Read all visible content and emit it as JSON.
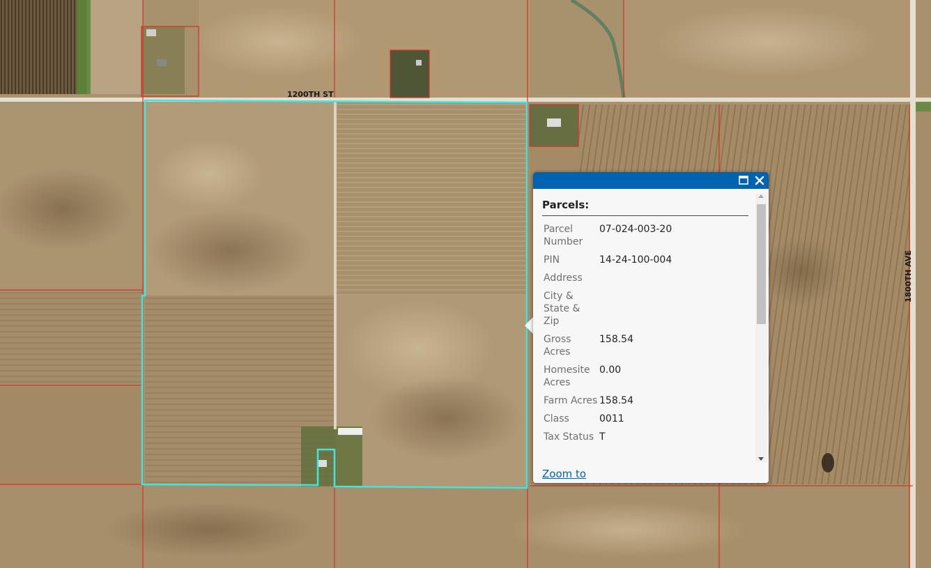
{
  "map": {
    "roads": {
      "horizontal_label": "1200TH ST",
      "vertical_label": "1800TH AVE"
    },
    "colors": {
      "field_base": "#a48a64",
      "parcel_line": "#d9302a",
      "selected_parcel": "#3ee6e0",
      "road": "#e6dfd0",
      "grass": "#5c8a3a"
    }
  },
  "popup": {
    "header_color": "#0063b1",
    "maximize_icon": "maximize-icon",
    "close_icon": "close-icon",
    "title": "Parcels:",
    "attributes": [
      {
        "name": "Parcel Number",
        "value": "07-024-003-20"
      },
      {
        "name": "PIN",
        "value": "14-24-100-004"
      },
      {
        "name": "Address",
        "value": ""
      },
      {
        "name": "City & State & Zip",
        "value": ""
      },
      {
        "name": "Gross Acres",
        "value": "158.54"
      },
      {
        "name": "Homesite Acres",
        "value": "0.00"
      },
      {
        "name": "Farm Acres",
        "value": "158.54"
      },
      {
        "name": "Class",
        "value": "0011"
      },
      {
        "name": "Tax Status",
        "value": "T"
      }
    ],
    "zoom_link": "Zoom to"
  }
}
